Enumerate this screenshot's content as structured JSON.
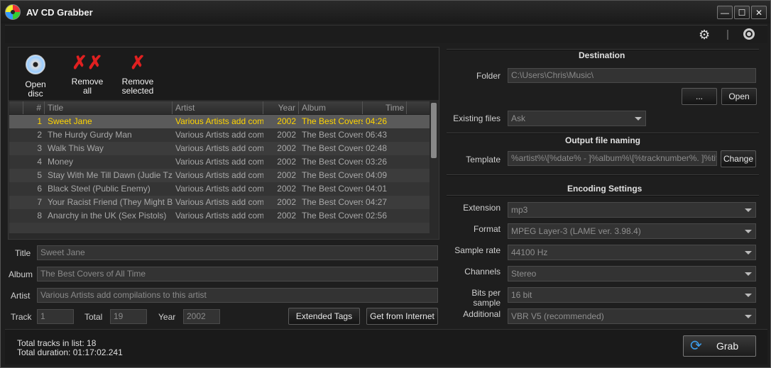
{
  "window": {
    "title": "AV CD Grabber",
    "minimize": "—",
    "maximize": "☐",
    "close": "✕"
  },
  "topbar": {
    "settings_icon": "gears-icon",
    "power_icon": "power-icon"
  },
  "toolbar": {
    "open_disc": "Open disc",
    "remove_all": "Remove all",
    "remove_selected_1": "Remove",
    "remove_selected_2": "selected"
  },
  "tracks": {
    "headers": {
      "num": "#",
      "title": "Title",
      "artist": "Artist",
      "year": "Year",
      "album": "Album",
      "time": "Time"
    },
    "rows": [
      {
        "num": "1",
        "title": "Sweet Jane",
        "artist": "Various Artists add compil",
        "year": "2002",
        "album": "The Best Covers o",
        "time": "04:26"
      },
      {
        "num": "2",
        "title": "The Hurdy Gurdy Man",
        "artist": "Various Artists add compil",
        "year": "2002",
        "album": "The Best Covers o",
        "time": "06:43"
      },
      {
        "num": "3",
        "title": "Walk This Way",
        "artist": "Various Artists add compil",
        "year": "2002",
        "album": "The Best Covers o",
        "time": "02:48"
      },
      {
        "num": "4",
        "title": "Money",
        "artist": "Various Artists add compil",
        "year": "2002",
        "album": "The Best Covers o",
        "time": "03:26"
      },
      {
        "num": "5",
        "title": "Stay With Me Till Dawn (Judie Tzuke",
        "artist": "Various Artists add compil",
        "year": "2002",
        "album": "The Best Covers o",
        "time": "04:09"
      },
      {
        "num": "6",
        "title": "Black Steel (Public Enemy)",
        "artist": "Various Artists add compil",
        "year": "2002",
        "album": "The Best Covers o",
        "time": "04:01"
      },
      {
        "num": "7",
        "title": "Your Racist Friend (They Might Be G",
        "artist": "Various Artists add compil",
        "year": "2002",
        "album": "The Best Covers o",
        "time": "04:27"
      },
      {
        "num": "8",
        "title": "Anarchy in the UK (Sex Pistols)",
        "artist": "Various Artists add compil",
        "year": "2002",
        "album": "The Best Covers o",
        "time": "02:56"
      }
    ]
  },
  "tags": {
    "title_label": "Title",
    "title_value": "Sweet Jane",
    "album_label": "Album",
    "album_value": "The Best Covers of All Time",
    "artist_label": "Artist",
    "artist_value": "Various Artists add compilations to this artist",
    "track_label": "Track",
    "track_value": "1",
    "total_label": "Total",
    "total_value": "19",
    "year_label": "Year",
    "year_value": "2002",
    "extended_tags": "Extended Tags",
    "get_from_internet": "Get from Internet"
  },
  "destination": {
    "header": "Destination",
    "folder_label": "Folder",
    "folder_value": "C:\\Users\\Chris\\Music\\",
    "browse": "...",
    "open": "Open",
    "existing_label": "Existing files",
    "existing_value": "Ask"
  },
  "naming": {
    "header": "Output file naming",
    "template_label": "Template",
    "template_value": "%artist%\\[%date% - ]%album%\\[%tracknumber%. ]%title%",
    "change": "Change"
  },
  "encoding": {
    "header": "Encoding Settings",
    "extension_label": "Extension",
    "extension_value": "mp3",
    "format_label": "Format",
    "format_value": "MPEG Layer-3 (LAME ver. 3.98.4)",
    "samplerate_label": "Sample rate",
    "samplerate_value": "44100 Hz",
    "channels_label": "Channels",
    "channels_value": "Stereo",
    "bits_label": "Bits per sample",
    "bits_value": "16 bit",
    "additional_label": "Additional",
    "additional_value": "VBR V5 (recommended)"
  },
  "status": {
    "total_tracks": "Total tracks in list: 18",
    "total_duration": "Total duration: 01:17:02.241"
  },
  "grab": {
    "label": "Grab"
  },
  "colors": {
    "selected_row_text": "#ffd400",
    "remove_icon": "#e02020",
    "grab_icon": "#3c9be8"
  }
}
